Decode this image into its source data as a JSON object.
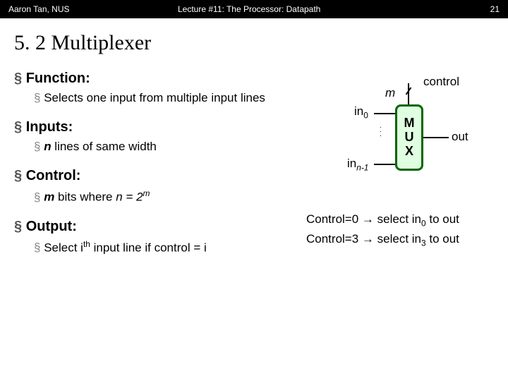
{
  "topbar": {
    "left": "Aaron Tan, NUS",
    "center": "Lecture #11: The Processor: Datapath",
    "right": "21"
  },
  "title": "5. 2 Multiplexer",
  "sections": {
    "function": {
      "heading": "Function:",
      "sub": "Selects one input from multiple input lines"
    },
    "inputs": {
      "heading": "Inputs:",
      "sub_prefix": "n",
      "sub_rest": " lines of same width"
    },
    "control": {
      "heading": "Control:",
      "sub_prefix": "m",
      "sub_mid": " bits where ",
      "sub_eq": "n = 2",
      "sub_exp": "m"
    },
    "output": {
      "heading": "Output:",
      "sub_pre": "Select i",
      "sub_sup": "th",
      "sub_post": " input line if control = i"
    }
  },
  "diagram": {
    "control": "control",
    "m": "m",
    "in0_pre": "in",
    "in0_sub": "0",
    "inn_pre": "in",
    "inn_sub": "n-1",
    "mux": {
      "l1": "M",
      "l2": "U",
      "l3": "X"
    },
    "out": "out",
    "dots": "."
  },
  "examples": {
    "r1_a": "Control=0 ",
    "r1_b": "→",
    "r1_c": " select in",
    "r1_sub": "0",
    "r1_d": " to out",
    "r2_a": "Control=3 ",
    "r2_b": "→",
    "r2_c": " select in",
    "r2_sub": "3",
    "r2_d": " to out"
  }
}
